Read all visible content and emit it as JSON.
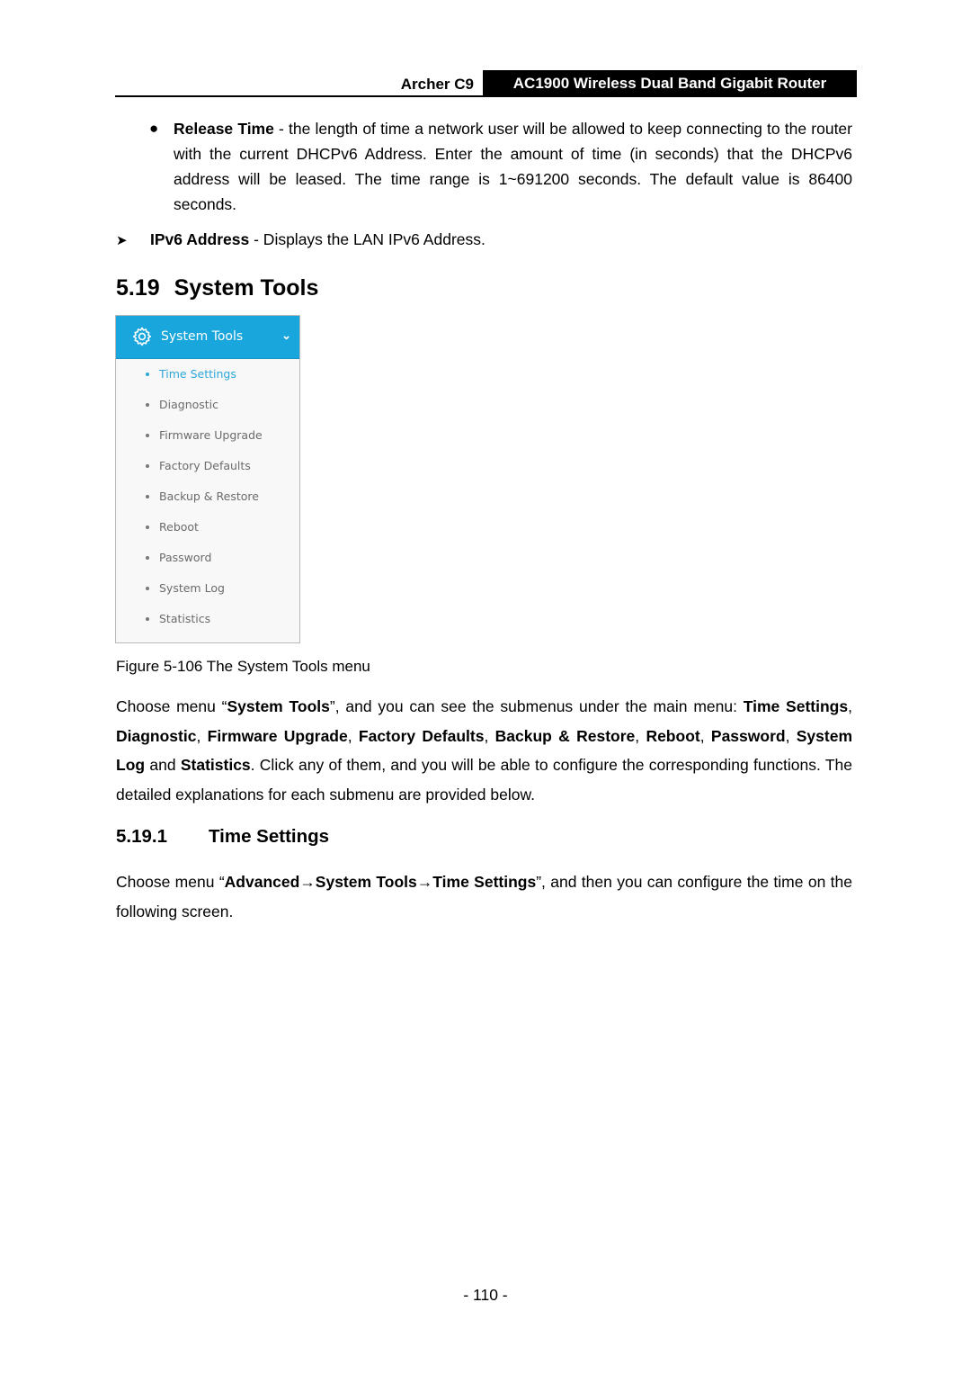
{
  "header": {
    "model": "Archer C9",
    "product": "AC1900 Wireless Dual Band Gigabit Router"
  },
  "release_time": {
    "term": "Release Time",
    "text": " - the length of time a network user will be allowed to keep connecting to the router with the current DHCPv6 Address. Enter the amount of time (in seconds) that the DHCPv6 address will be leased. The time range is 1~691200 seconds. The default value is 86400 seconds."
  },
  "ipv6_address": {
    "term": "IPv6 Address",
    "text": " - Displays the LAN IPv6 Address."
  },
  "section": {
    "number": "5.19",
    "title": "System Tools"
  },
  "menu": {
    "title": "System Tools",
    "icon": "gear-icon",
    "expand_icon": "chevron-down-icon",
    "colors": {
      "header": "#19a6dc",
      "active": "#2ea7d8",
      "item": "#6b6b6b"
    },
    "items": [
      {
        "label": "Time Settings",
        "active": true
      },
      {
        "label": "Diagnostic",
        "active": false
      },
      {
        "label": "Firmware Upgrade",
        "active": false
      },
      {
        "label": "Factory Defaults",
        "active": false
      },
      {
        "label": "Backup & Restore",
        "active": false
      },
      {
        "label": "Reboot",
        "active": false
      },
      {
        "label": "Password",
        "active": false
      },
      {
        "label": "System Log",
        "active": false
      },
      {
        "label": "Statistics",
        "active": false
      }
    ]
  },
  "caption": "Figure 5-106 The System Tools menu",
  "paragraph1": {
    "t1": "Choose menu “",
    "b1": "System Tools",
    "t2": "”, and you can see the submenus under the main menu: ",
    "b2": "Time Settings",
    "t3": ", ",
    "b3": "Diagnostic",
    "t4": ", ",
    "b4": "Firmware Upgrade",
    "t5": ", ",
    "b5": "Factory Defaults",
    "t6": ", ",
    "b6": "Backup & Restore",
    "t7": ", ",
    "b7": "Reboot",
    "t8": ", ",
    "b8": "Password",
    "t9": ", ",
    "b9": "System Log",
    "t10": " and ",
    "b10": "Statistics",
    "t11": ". Click any of them, and you will be able to configure the corresponding functions. The detailed explanations for each submenu are provided below."
  },
  "subsection": {
    "number": "5.19.1",
    "title": "Time Settings"
  },
  "paragraph2": {
    "t1": "Choose menu “",
    "b1": "Advanced→System Tools→Time Settings",
    "t2": "”, and then you can configure the time on the following screen."
  },
  "page_number": "- 110 -"
}
